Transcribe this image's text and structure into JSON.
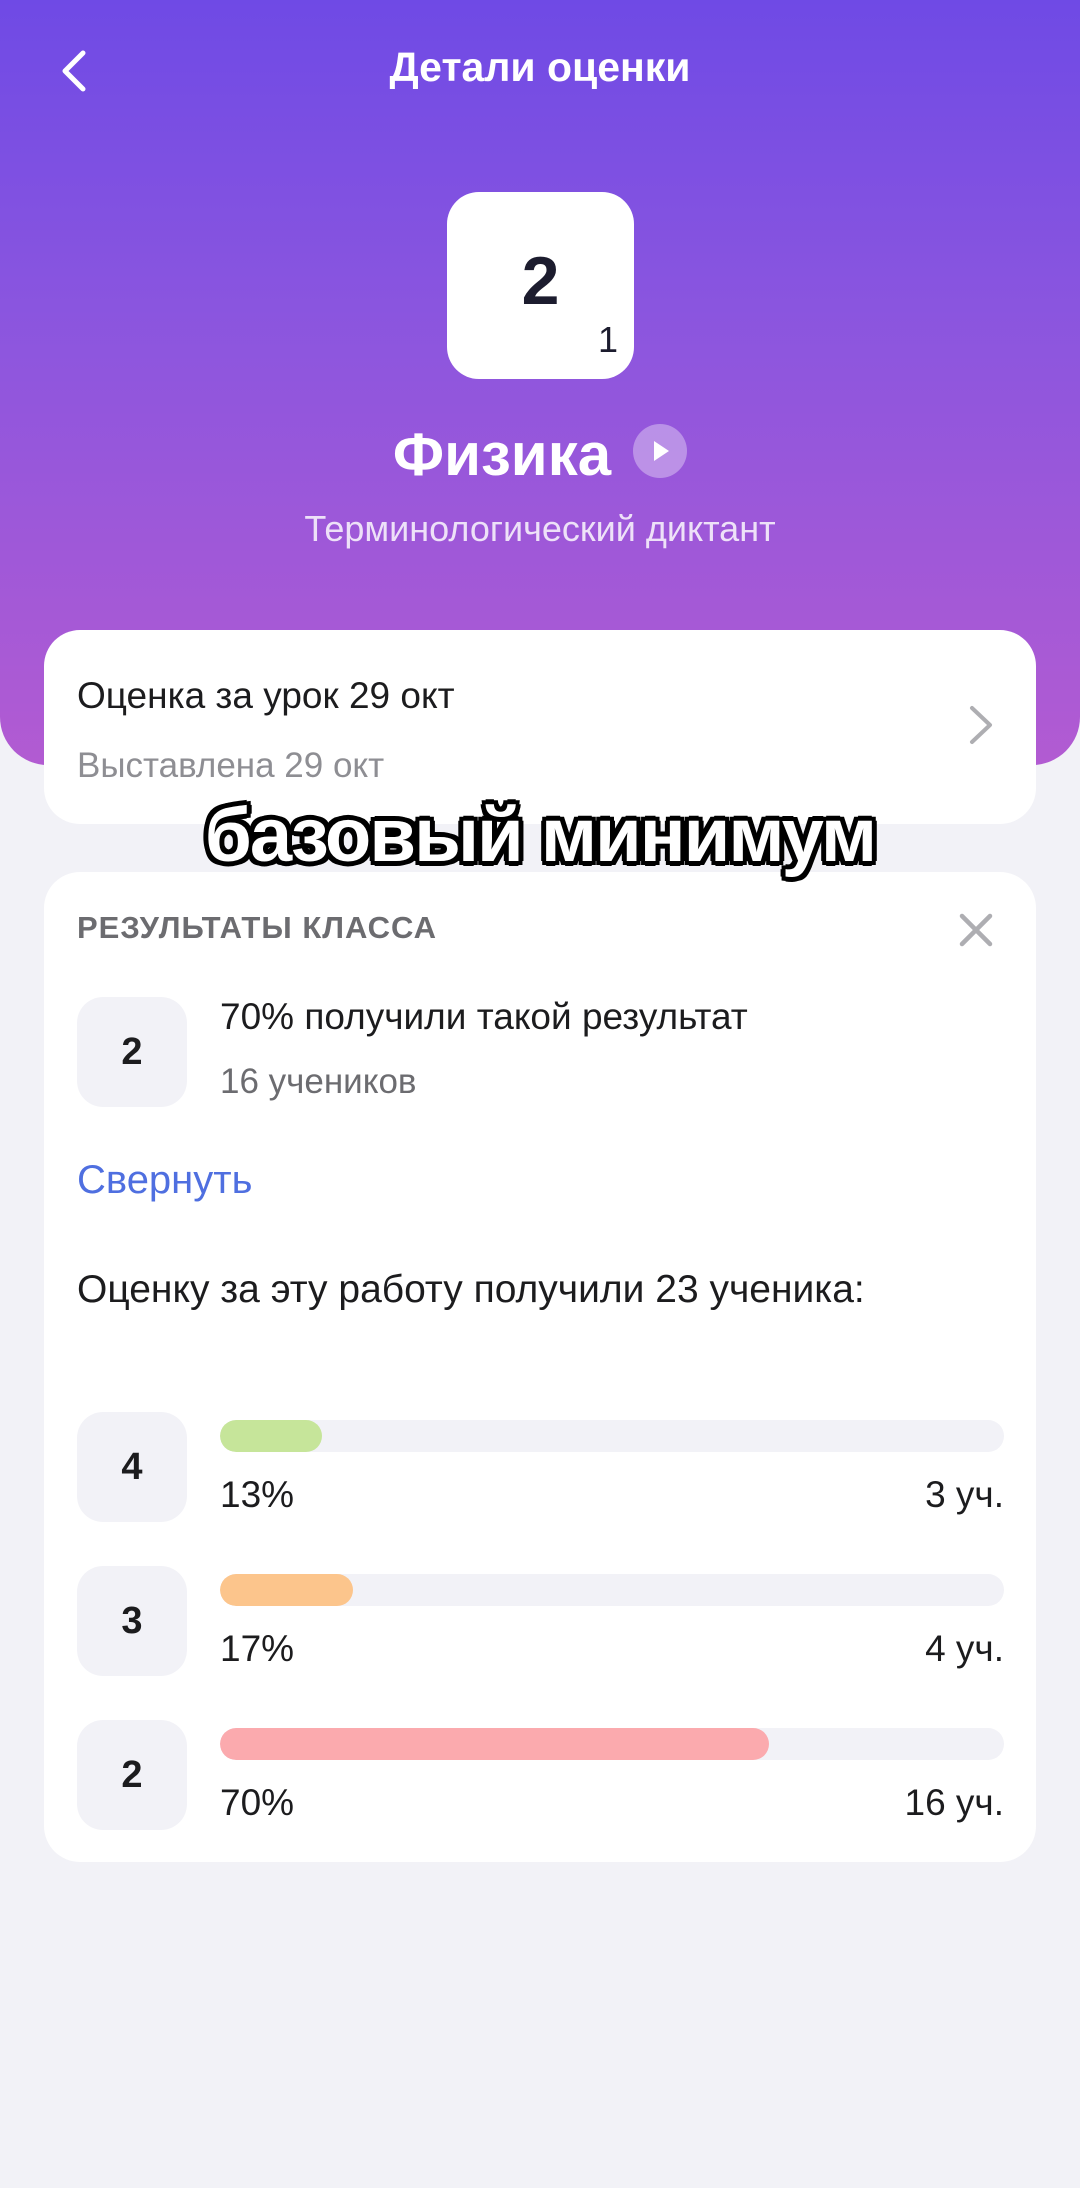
{
  "header": {
    "title": "Детали оценки",
    "grade": "2",
    "grade_weight": "1",
    "subject": "Физика",
    "work_type": "Терминологический диктант"
  },
  "lesson": {
    "title": "Оценка за урок 29 окт",
    "subtitle": "Выставлена 29 окт"
  },
  "caption": "базовый минимум",
  "class_results": {
    "section_title": "РЕЗУЛЬТАТЫ КЛАССА",
    "summary_grade": "2",
    "summary_text": "70% получили такой результат",
    "summary_students": "16 учеников",
    "collapse_label": "Свернуть",
    "distribution_heading": "Оценку за эту работу получили 23 ученика:",
    "distribution": [
      {
        "grade": "4",
        "percent_label": "13%",
        "percent": 13,
        "count_label": "3 уч.",
        "color": "#c6e59a"
      },
      {
        "grade": "3",
        "percent_label": "17%",
        "percent": 17,
        "count_label": "4 уч.",
        "color": "#fcc58c"
      },
      {
        "grade": "2",
        "percent_label": "70%",
        "percent": 70,
        "count_label": "16 уч.",
        "color": "#fbaaae"
      }
    ]
  },
  "colors": {
    "header_gradient_top": "#6f4ae5",
    "header_gradient_bottom": "#b25bd2",
    "link": "#4f6fe0",
    "background": "#f2f2f7"
  },
  "icons": {
    "back": "chevron-left-icon",
    "play": "play-icon",
    "lesson_chevron": "chevron-right-icon",
    "close": "close-icon"
  }
}
